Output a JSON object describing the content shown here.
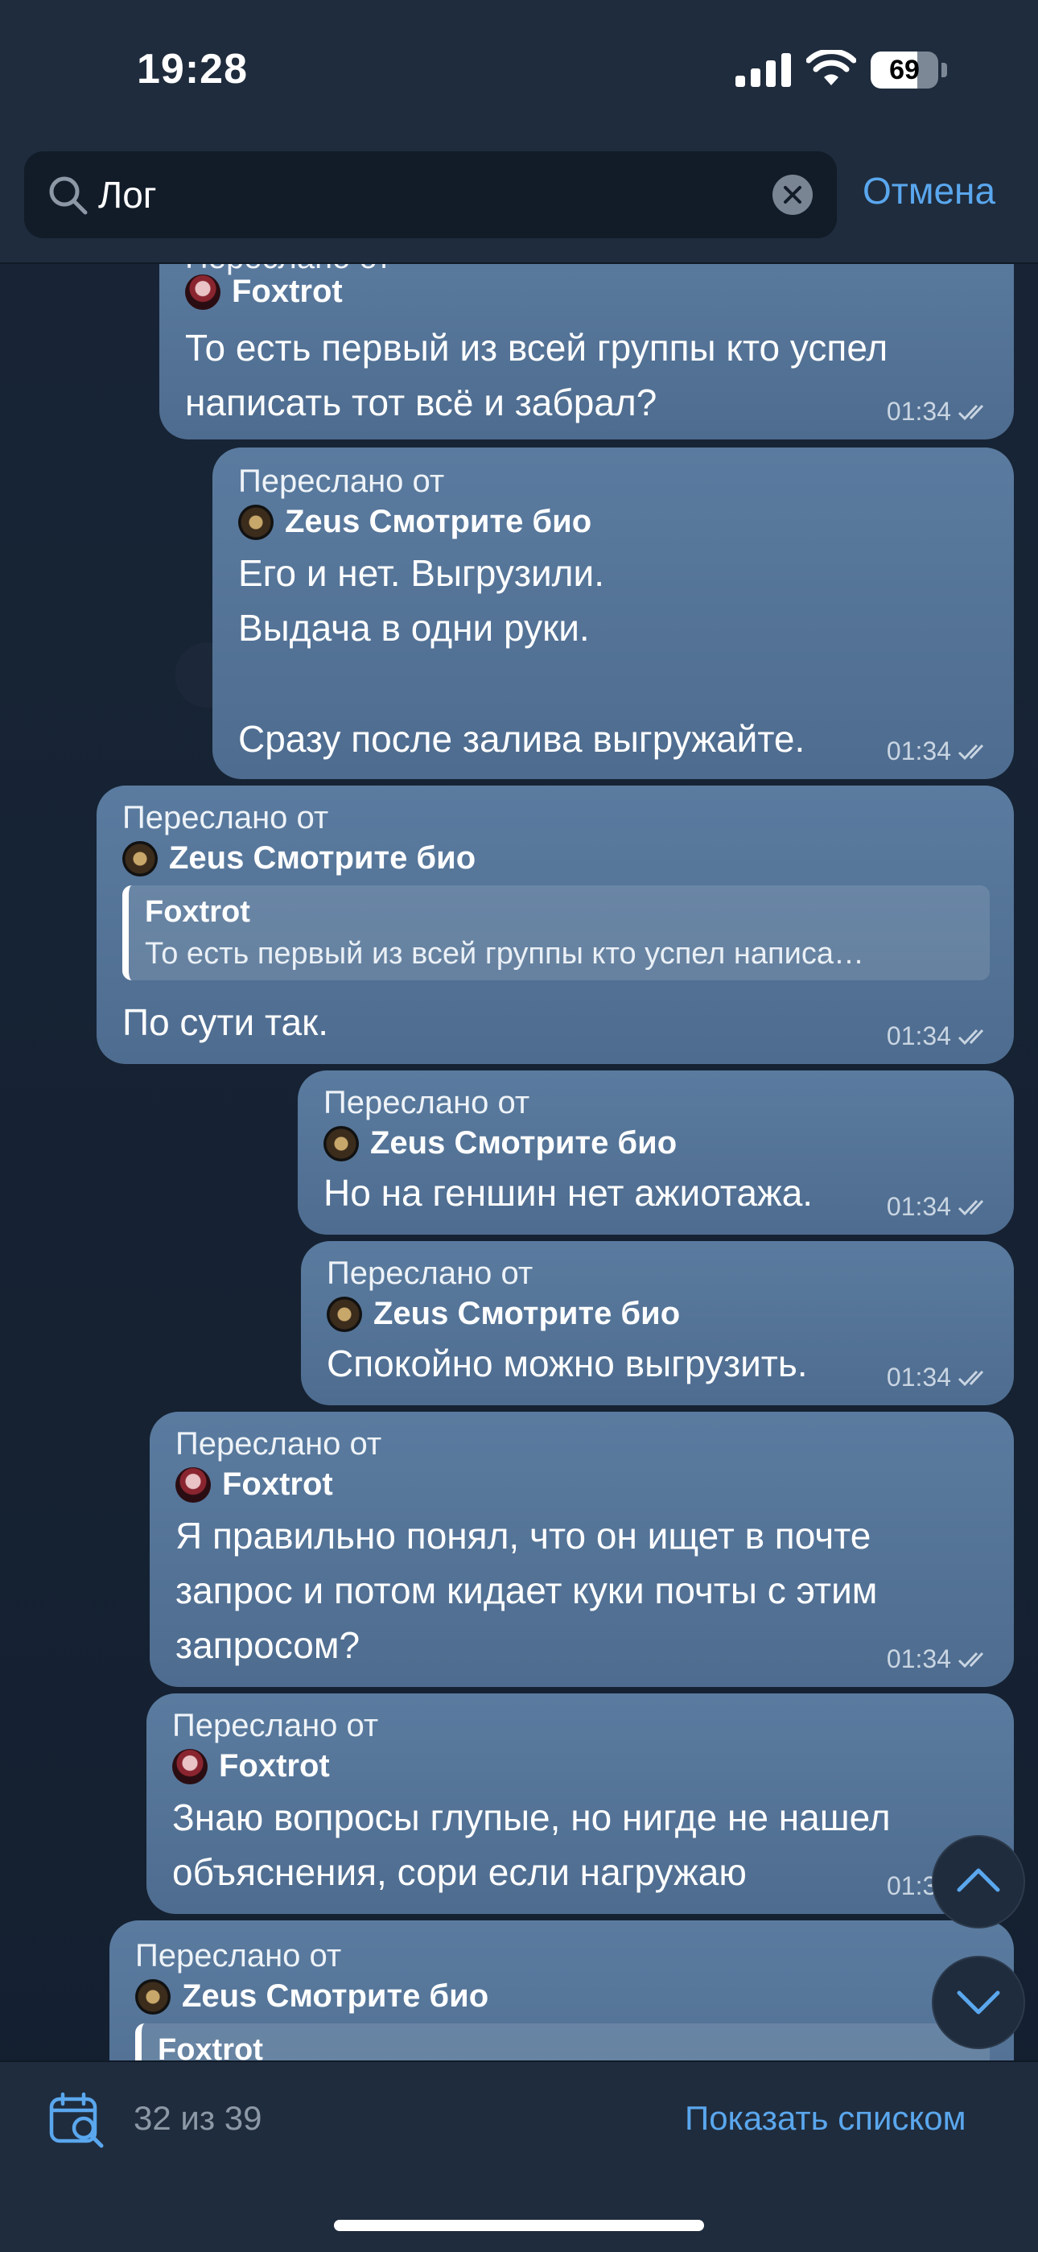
{
  "status_bar": {
    "time": "19:28",
    "battery": "69",
    "battery_level": 0.69
  },
  "search": {
    "value": "Лог",
    "cancel_label": "Отмена"
  },
  "messages": [
    {
      "forward_label": "Переслано от",
      "author": "Foxtrot",
      "lines": [
        "То есть первый из всей группы кто успел",
        "написать тот всё и забрал?"
      ],
      "time": "01:34"
    },
    {
      "forward_label": "Переслано от",
      "author": "Zeus Смотрите био",
      "lines": [
        "Его и нет. Выгрузили.",
        "Выдача в одни руки.",
        "",
        "Сразу после залива выгружайте."
      ],
      "time": "01:34"
    },
    {
      "forward_label": "Переслано от",
      "author": "Zeus Смотрите био",
      "quote": {
        "author": "Foxtrot",
        "text": "То есть первый из всей группы кто успел написа…"
      },
      "lines": [
        "По сути так."
      ],
      "time": "01:34"
    },
    {
      "forward_label": "Переслано от",
      "author": "Zeus Смотрите био",
      "lines": [
        "Но на геншин нет ажиотажа."
      ],
      "time": "01:34"
    },
    {
      "forward_label": "Переслано от",
      "author": "Zeus Смотрите био",
      "lines": [
        "Спокойно можно выгрузить."
      ],
      "time": "01:34"
    },
    {
      "forward_label": "Переслано от",
      "author": "Foxtrot",
      "lines": [
        "Я правильно понял, что он ищет в почте",
        "запрос и потом кидает куки почты с этим",
        "запросом?"
      ],
      "time": "01:34"
    },
    {
      "forward_label": "Переслано от",
      "author": "Foxtrot",
      "lines": [
        "Знаю вопросы глупые, но нигде не нашел",
        "объяснения, сори если нагружаю"
      ],
      "time": "01:3"
    },
    {
      "forward_label": "Переслано от",
      "author": "Zeus Смотрите био",
      "quote": {
        "author": "Foxtrot",
        "text": ""
      },
      "lines": [],
      "time": ""
    }
  ],
  "bottom_bar": {
    "result_count": "32 из 39",
    "list_button": "Показать списком"
  },
  "colors": {
    "accent": "#5aa7ee",
    "bubble": "#587a9e",
    "background": "#162232",
    "bar": "#1f2c3d"
  }
}
